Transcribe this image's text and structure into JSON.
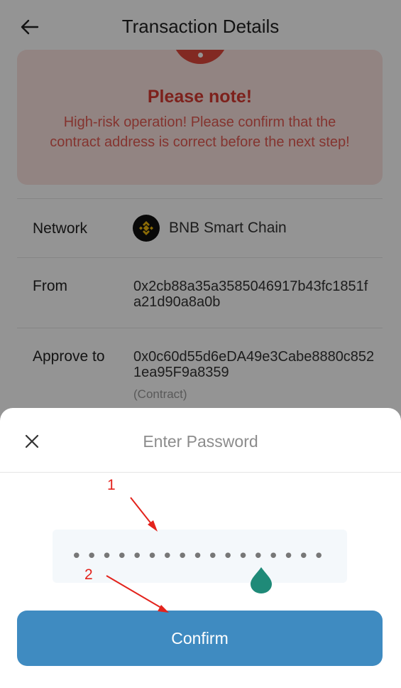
{
  "header": {
    "title": "Transaction Details"
  },
  "note": {
    "title": "Please note!",
    "message": "High-risk operation! Please confirm that the contract address is correct before the next step!"
  },
  "details": {
    "network_label": "Network",
    "network_value": "BNB Smart Chain",
    "from_label": "From",
    "from_value": "0x2cb88a35a3585046917b43fc1851fa21d90a8a0b",
    "approve_label": "Approve to",
    "approve_value": "0x0c60d55d6eDA49e3Cabe8880c8521ea95F9a8359",
    "contract_tag": "(Contract)"
  },
  "sheet": {
    "title": "Enter Password",
    "password_value": "•••••••••••••••••",
    "confirm_label": "Confirm"
  },
  "annotations": {
    "step1": "1",
    "step2": "2"
  },
  "colors": {
    "accent": "#3f8bc1",
    "warning": "#d83a31",
    "annotation": "#e3231c",
    "drop": "#1f8a78"
  },
  "icons": {
    "back": "arrow-left-icon",
    "close": "close-icon",
    "network": "bnb-logo-icon",
    "drop": "drop-icon"
  }
}
